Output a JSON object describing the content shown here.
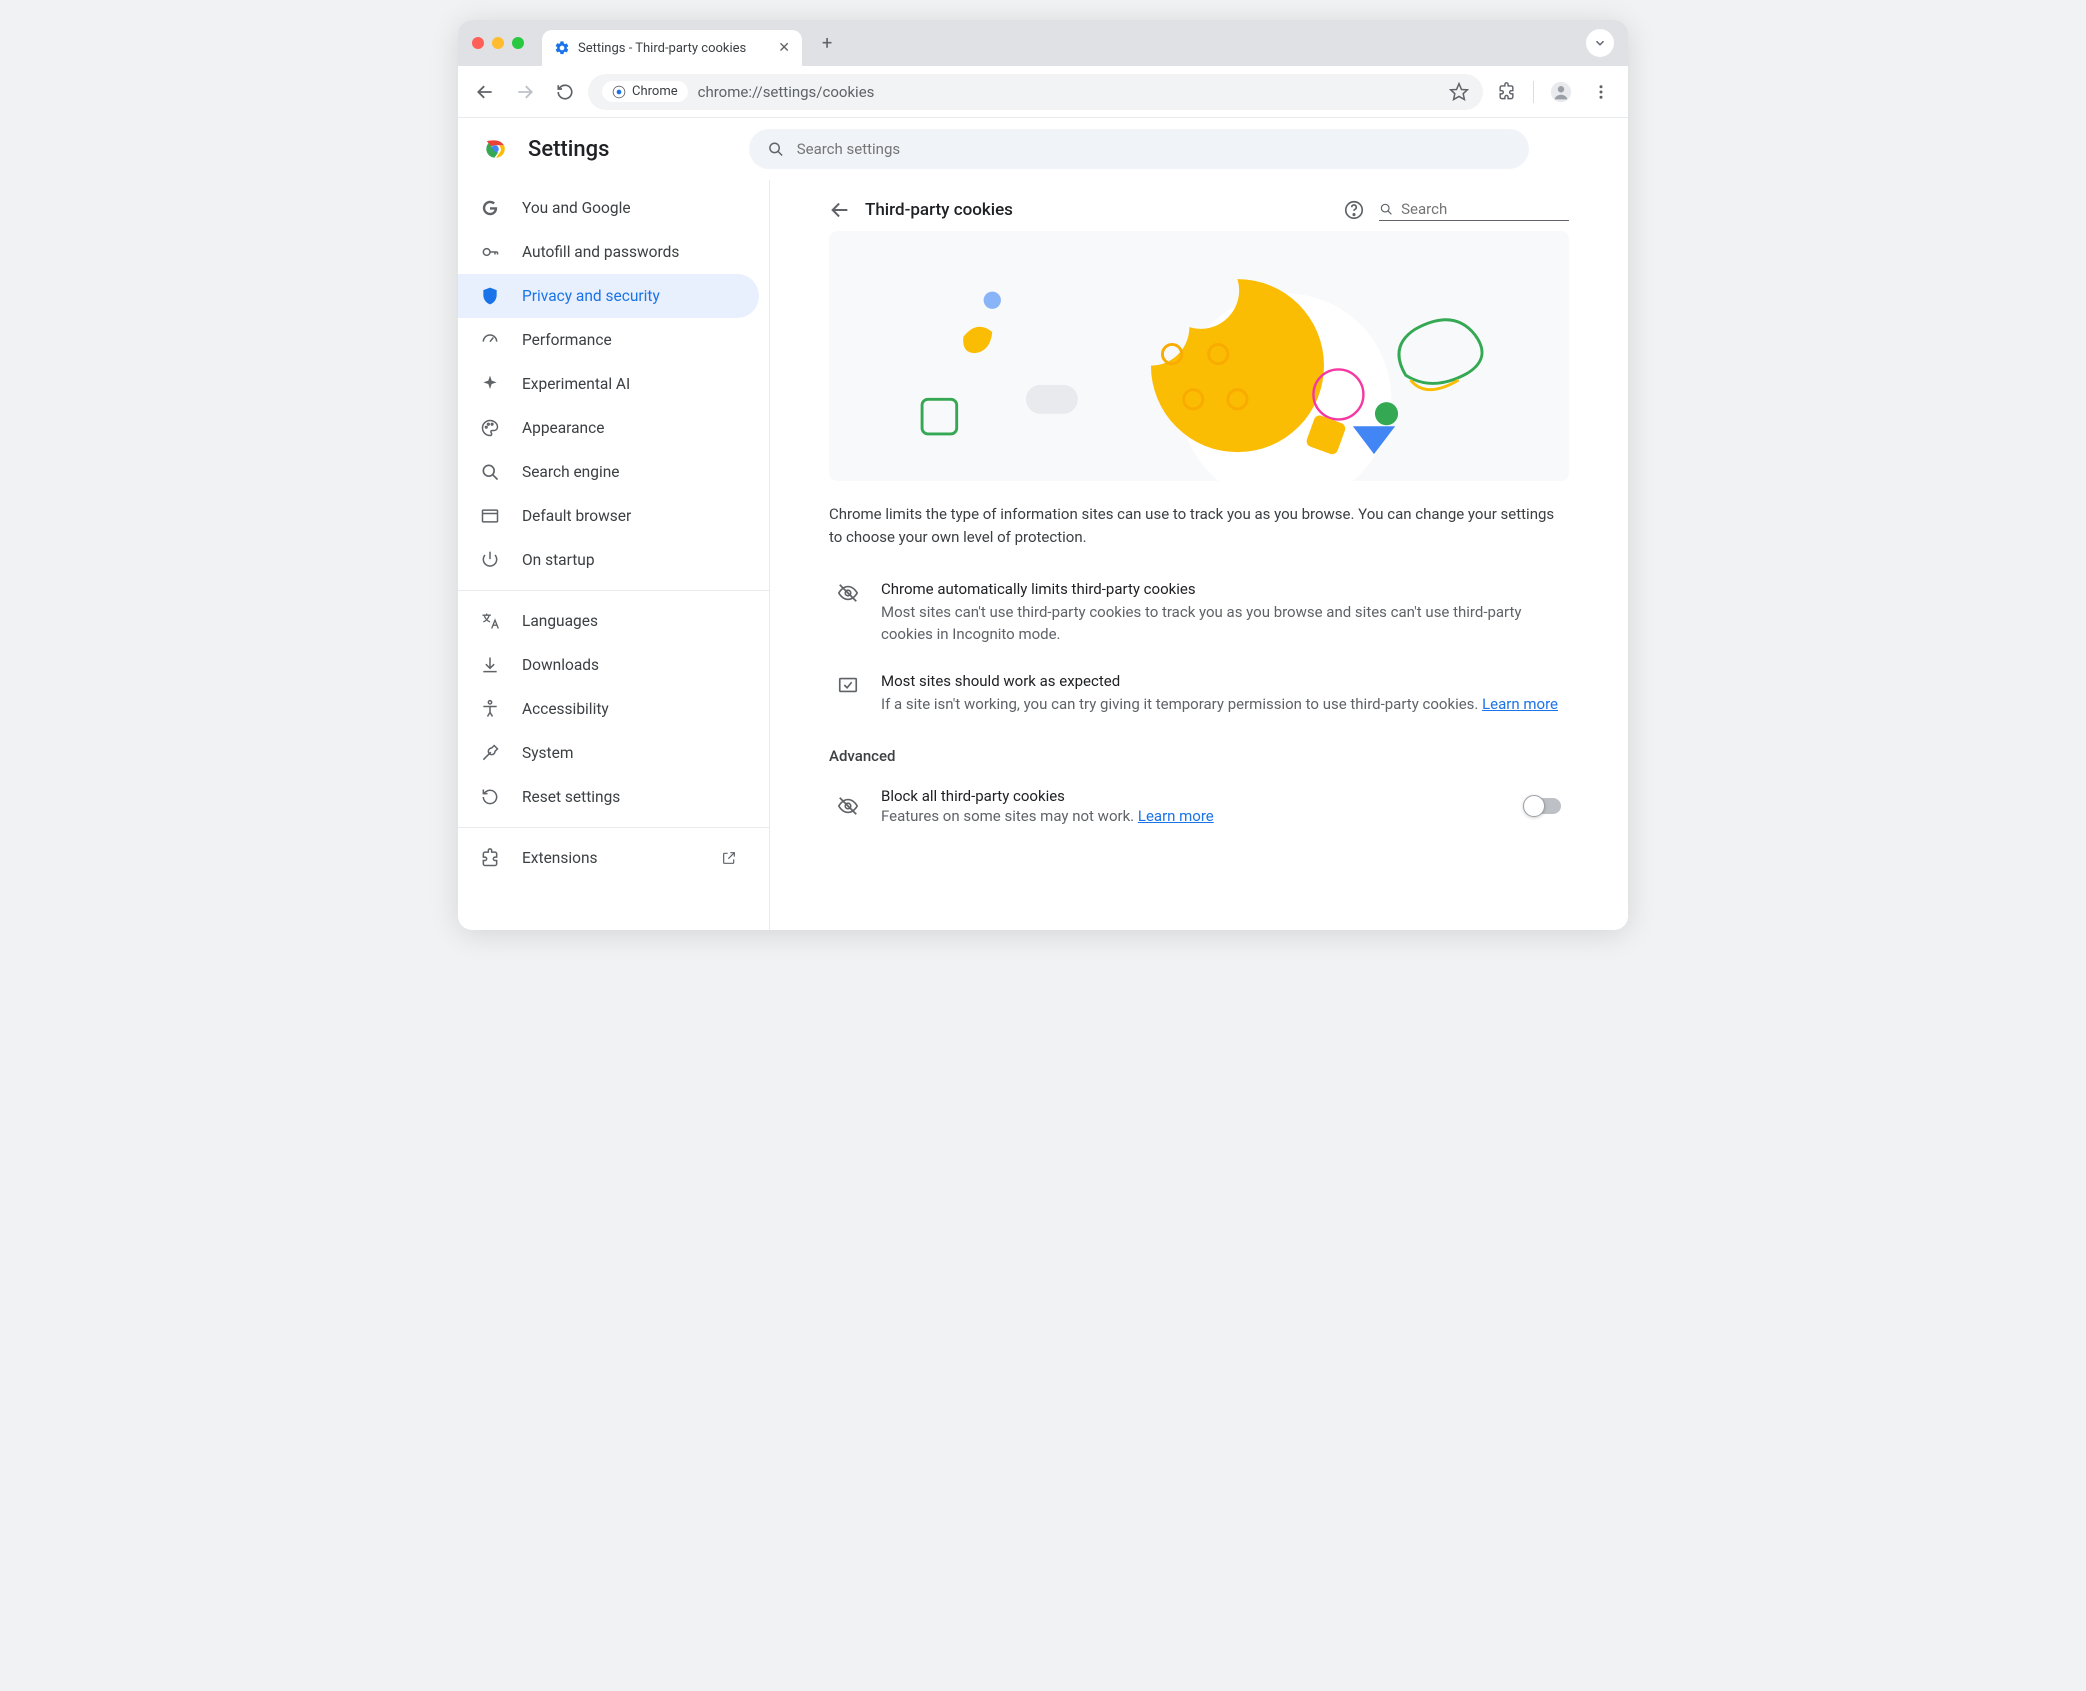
{
  "tab": {
    "title": "Settings - Third-party cookies"
  },
  "toolbar": {
    "chip": "Chrome",
    "url": "chrome://settings/cookies"
  },
  "header": {
    "title": "Settings",
    "search_placeholder": "Search settings"
  },
  "sidebar": {
    "items": [
      {
        "label": "You and Google"
      },
      {
        "label": "Autofill and passwords"
      },
      {
        "label": "Privacy and security"
      },
      {
        "label": "Performance"
      },
      {
        "label": "Experimental AI"
      },
      {
        "label": "Appearance"
      },
      {
        "label": "Search engine"
      },
      {
        "label": "Default browser"
      },
      {
        "label": "On startup"
      }
    ],
    "items2": [
      {
        "label": "Languages"
      },
      {
        "label": "Downloads"
      },
      {
        "label": "Accessibility"
      },
      {
        "label": "System"
      },
      {
        "label": "Reset settings"
      }
    ],
    "ext": "Extensions"
  },
  "page": {
    "title": "Third-party cookies",
    "search_placeholder": "Search",
    "intro": "Chrome limits the type of information sites can use to track you as you browse. You can change your settings to choose your own level of protection.",
    "info1_title": "Chrome automatically limits third-party cookies",
    "info1_body": "Most sites can't use third-party cookies to track you as you browse and sites can't use third-party cookies in Incognito mode.",
    "info2_title": "Most sites should work as expected",
    "info2_body": "If a site isn't working, you can try giving it temporary permission to use third-party cookies. ",
    "learn_more": "Learn more",
    "advanced": "Advanced",
    "opt1_title": "Block all third-party cookies",
    "opt1_body": "Features on some sites may not work. "
  }
}
